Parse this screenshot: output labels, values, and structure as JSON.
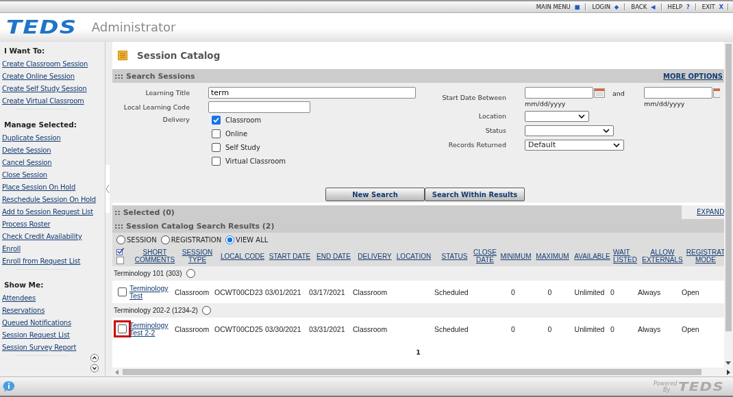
{
  "top_nav": [
    {
      "label": "MAIN MENU",
      "glyph": "■"
    },
    {
      "label": "LOGIN",
      "glyph": "◆"
    },
    {
      "label": "BACK",
      "glyph": "◀"
    },
    {
      "label": "HELP",
      "glyph": "?"
    },
    {
      "label": "EXIT",
      "glyph": "X"
    }
  ],
  "header": {
    "logo": "TEDS",
    "app": "Administrator"
  },
  "sidebar": [
    {
      "heading": "I Want To:",
      "items": [
        "Create Classroom Session",
        "Create Online Session",
        "Create Self Study Session",
        "Create Virtual Classroom"
      ]
    },
    {
      "heading": "Manage Selected:",
      "items": [
        "Duplicate Session",
        "Delete Session",
        "Cancel Session",
        "Close Session",
        "Place Session On Hold",
        "Reschedule Session On Hold",
        "Add to Session Request List",
        "Process Roster",
        "Check Credit Availability",
        "Enroll",
        "Enroll from Request List"
      ]
    },
    {
      "heading": "Show Me:",
      "items": [
        "Attendees",
        "Reservations",
        "Queued Notifications",
        "Session Request List",
        "Session Survey Report"
      ]
    }
  ],
  "page_title": "Session Catalog",
  "search": {
    "title": "::: Search Sessions",
    "more": "MORE OPTIONS",
    "learning_title": {
      "label": "Learning Title",
      "value": "term"
    },
    "local_code": {
      "label": "Local Learning Code"
    },
    "delivery": {
      "label": "Delivery",
      "options": [
        {
          "label": "Classroom",
          "checked": true
        },
        {
          "label": "Online",
          "checked": false
        },
        {
          "label": "Self Study",
          "checked": false
        },
        {
          "label": "Virtual Classroom",
          "checked": false
        }
      ]
    },
    "start_date": {
      "label": "Start Date Between",
      "and": "and",
      "hint1": "mm/dd/yyyy",
      "hint2": "mm/dd/yyyy"
    },
    "location": {
      "label": "Location"
    },
    "status": {
      "label": "Status"
    },
    "records": {
      "label": "Records Returned",
      "value": "Default"
    },
    "buttons": [
      "New Search",
      "Search Within Results"
    ]
  },
  "selected_bar": {
    "title": ":: Selected (0)",
    "expand": "EXPAND"
  },
  "results": {
    "title": "::: Session Catalog Search Results (2)",
    "views": [
      {
        "label": "SESSION",
        "selected": false
      },
      {
        "label": "REGISTRATION",
        "selected": false
      },
      {
        "label": "VIEW ALL",
        "selected": true
      }
    ],
    "select_all_checked": true,
    "clear_all_checked": false,
    "columns": [
      "SHORT COMMENTS",
      "SESSION TYPE",
      "LOCAL CODE",
      "START DATE",
      "END DATE",
      "DELIVERY",
      "LOCATION",
      "STATUS",
      "CLOSE DATE",
      "MINIMUM",
      "MAXIMUM",
      "AVAILABLE",
      "WAIT LISTED",
      "ALLOW EXTERNALS",
      "REGISTRAT MODE"
    ],
    "groups": [
      {
        "title": "Terminology 101 (303)",
        "selected": false,
        "rows": [
          {
            "checked": false,
            "highlighted": false,
            "cells": [
              "Terminology Test",
              "Classroom",
              "OCWT00CD23",
              "03/01/2021",
              "03/17/2021",
              "Classroom",
              "",
              "Scheduled",
              "",
              "0",
              "0",
              "Unlimited",
              "0",
              "Always",
              "Open"
            ]
          }
        ]
      },
      {
        "title": "Terminology 202-2 (1234-2)",
        "selected": false,
        "rows": [
          {
            "checked": false,
            "highlighted": true,
            "cells": [
              "Terminology Test 2-2",
              "Classroom",
              "OCWT00CD25",
              "03/30/2021",
              "03/31/2021",
              "Classroom",
              "",
              "Scheduled",
              "",
              "0",
              "0",
              "Unlimited",
              "0",
              "Always",
              "Open"
            ]
          }
        ]
      }
    ],
    "page": "1"
  },
  "footer": {
    "powered": "Powered",
    "by": "By",
    "logo": "TEDS"
  }
}
